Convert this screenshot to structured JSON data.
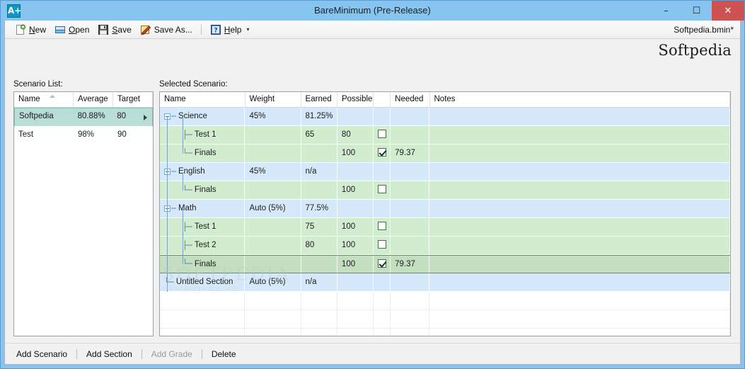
{
  "window": {
    "title": "BareMinimum (Pre-Release)",
    "app_icon": "A+",
    "minimize": "–",
    "maximize": "☐",
    "close": "✕",
    "accent_titlebar": "#86c5ef",
    "accent_close": "#cf5252"
  },
  "toolbar": {
    "new_label": "New",
    "open_label": "Open",
    "save_label": "Save",
    "save_as_label": "Save As...",
    "help_label": "Help",
    "dropdown_caret": "▾",
    "file_name": "Softpedia.bmin*"
  },
  "brand": {
    "text": "Softpedia"
  },
  "watermark": {
    "big": "SOFTPEDIA",
    "tm": "™",
    "small": "www.softpedia.com"
  },
  "left_panel": {
    "label": "Scenario List:",
    "columns": [
      "Name",
      "Average",
      "Target"
    ],
    "sorted_column": "Name",
    "rows": [
      {
        "name": "Softpedia",
        "average": "80.88%",
        "target": "80",
        "selected": true,
        "arrow": "▸"
      },
      {
        "name": "Test",
        "average": "98%",
        "target": "90",
        "selected": false,
        "arrow": ""
      }
    ]
  },
  "right_panel": {
    "label": "Selected Scenario:",
    "columns": [
      "Name",
      "Weight",
      "Earned",
      "Possible",
      "",
      "Needed",
      "Notes"
    ],
    "rows": [
      {
        "kind": "section",
        "depth": 0,
        "name": "Science",
        "weight": "45%",
        "earned": "81.25%",
        "possible": "",
        "checkbox": null,
        "needed": "",
        "notes": "",
        "selected": false,
        "expander": true,
        "connector": "none"
      },
      {
        "kind": "grade",
        "depth": 1,
        "name": "Test 1",
        "weight": "",
        "earned": "65",
        "possible": "80",
        "checkbox": false,
        "needed": "",
        "notes": "",
        "selected": false,
        "expander": false,
        "connector": "tee"
      },
      {
        "kind": "grade",
        "depth": 1,
        "name": "Finals",
        "weight": "",
        "earned": "",
        "possible": "100",
        "checkbox": true,
        "needed": "79.37",
        "notes": "",
        "selected": false,
        "expander": false,
        "connector": "ell"
      },
      {
        "kind": "section",
        "depth": 0,
        "name": "English",
        "weight": "45%",
        "earned": "n/a",
        "possible": "",
        "checkbox": null,
        "needed": "",
        "notes": "",
        "selected": false,
        "expander": true,
        "connector": "none"
      },
      {
        "kind": "grade",
        "depth": 1,
        "name": "Finals",
        "weight": "",
        "earned": "",
        "possible": "100",
        "checkbox": false,
        "needed": "",
        "notes": "",
        "selected": false,
        "expander": false,
        "connector": "ell"
      },
      {
        "kind": "section",
        "depth": 0,
        "name": "Math",
        "weight": "Auto (5%)",
        "earned": "77.5%",
        "possible": "",
        "checkbox": null,
        "needed": "",
        "notes": "",
        "selected": false,
        "expander": true,
        "connector": "none"
      },
      {
        "kind": "grade",
        "depth": 1,
        "name": "Test 1",
        "weight": "",
        "earned": "75",
        "possible": "100",
        "checkbox": false,
        "needed": "",
        "notes": "",
        "selected": false,
        "expander": false,
        "connector": "tee"
      },
      {
        "kind": "grade",
        "depth": 1,
        "name": "Test 2",
        "weight": "",
        "earned": "80",
        "possible": "100",
        "checkbox": false,
        "needed": "",
        "notes": "",
        "selected": false,
        "expander": false,
        "connector": "tee"
      },
      {
        "kind": "grade",
        "depth": 1,
        "name": "Finals",
        "weight": "",
        "earned": "",
        "possible": "100",
        "checkbox": true,
        "needed": "79.37",
        "notes": "",
        "selected": true,
        "expander": false,
        "connector": "ell"
      },
      {
        "kind": "section",
        "depth": 0,
        "name": "Untitled Section",
        "weight": "Auto (5%)",
        "earned": "n/a",
        "possible": "",
        "checkbox": null,
        "needed": "",
        "notes": "",
        "selected": false,
        "expander": false,
        "connector": "ell0"
      },
      {
        "kind": "empty",
        "depth": 0,
        "name": "",
        "weight": "",
        "earned": "",
        "possible": "",
        "checkbox": null,
        "needed": "",
        "notes": "",
        "selected": false,
        "expander": false,
        "connector": "none"
      },
      {
        "kind": "empty",
        "depth": 0,
        "name": "",
        "weight": "",
        "earned": "",
        "possible": "",
        "checkbox": null,
        "needed": "",
        "notes": "",
        "selected": false,
        "expander": false,
        "connector": "none"
      },
      {
        "kind": "empty",
        "depth": 0,
        "name": "",
        "weight": "",
        "earned": "",
        "possible": "",
        "checkbox": null,
        "needed": "",
        "notes": "",
        "selected": false,
        "expander": false,
        "connector": "none"
      },
      {
        "kind": "empty",
        "depth": 0,
        "name": "",
        "weight": "",
        "earned": "",
        "possible": "",
        "checkbox": null,
        "needed": "",
        "notes": "",
        "selected": false,
        "expander": false,
        "connector": "none"
      }
    ],
    "colors": {
      "section_row": "#d6e9fb",
      "grade_row": "#d2ecd0",
      "selected_row": "#c3dfc0"
    }
  },
  "bottom_bar": {
    "items": [
      {
        "label": "Add Scenario",
        "enabled": true
      },
      {
        "label": "Add Section",
        "enabled": true
      },
      {
        "label": "Add Grade",
        "enabled": false
      },
      {
        "label": "Delete",
        "enabled": true
      }
    ]
  }
}
